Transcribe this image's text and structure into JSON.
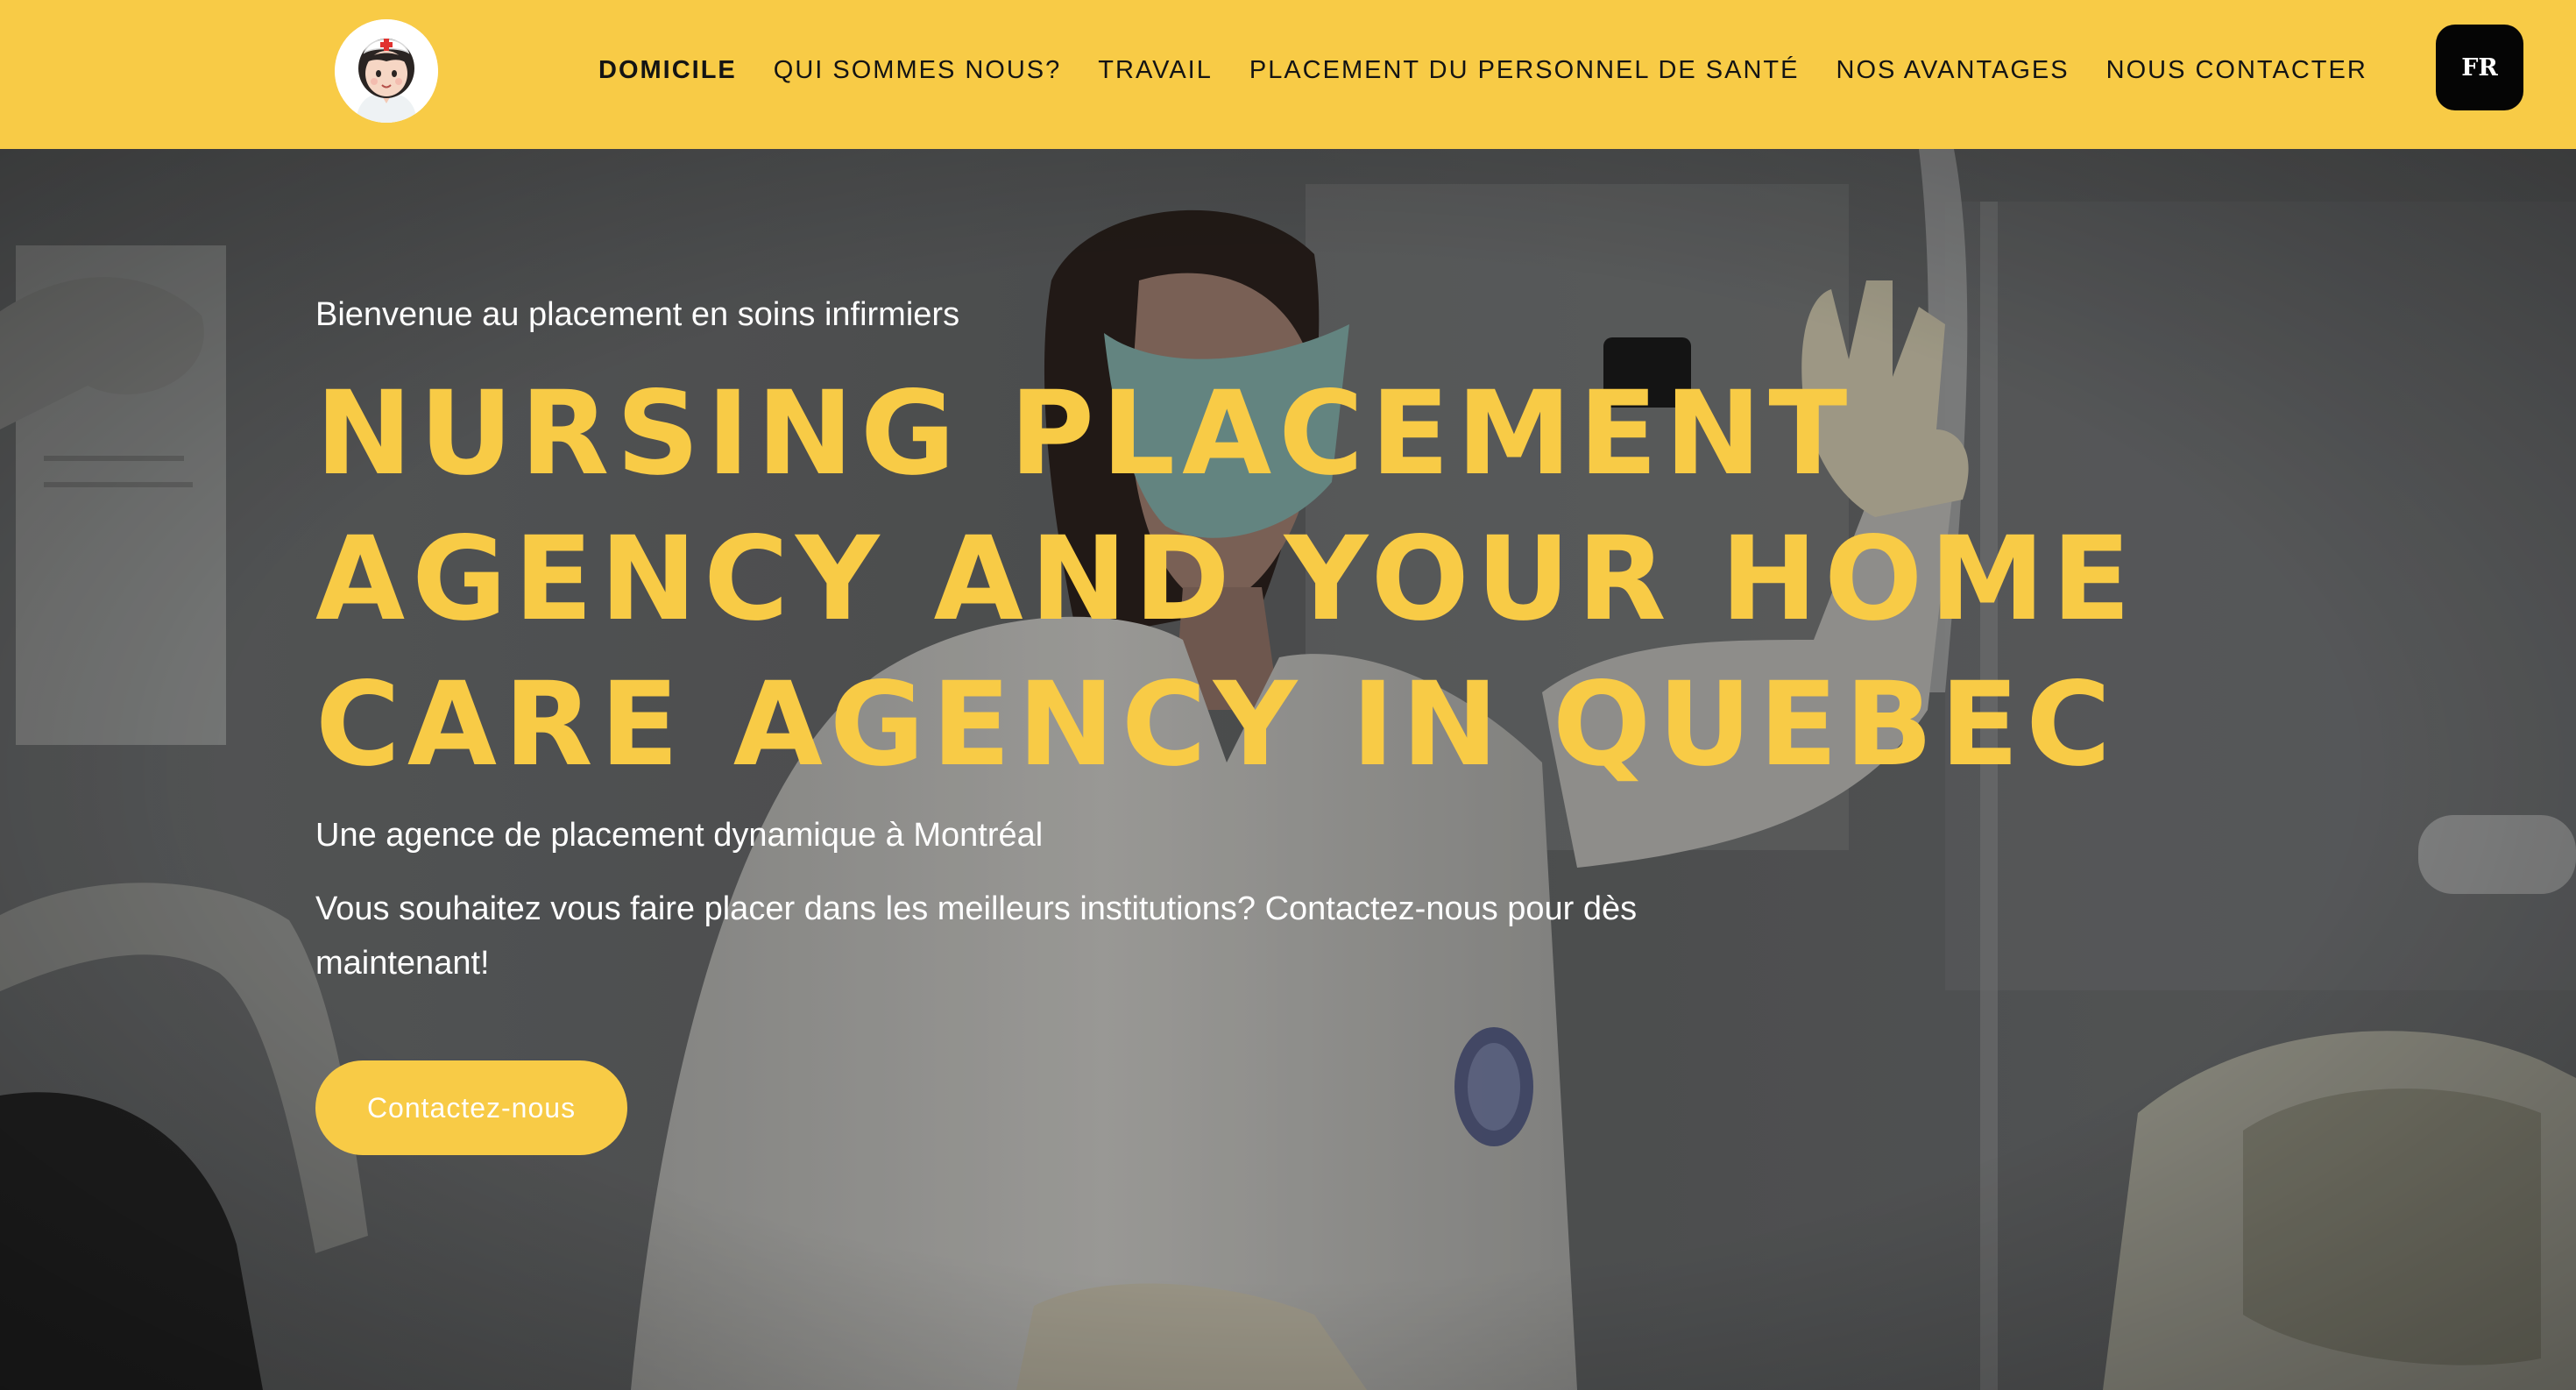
{
  "colors": {
    "accent": "#f8cb46",
    "header_bg": "#f8cb46",
    "lang_button_bg": "#050505",
    "text_dark": "#141414",
    "text_light": "#ffffff"
  },
  "header": {
    "logo_icon": "nurse-avatar-icon",
    "nav": [
      {
        "label": "DOMICILE",
        "active": true
      },
      {
        "label": "QUI SOMMES NOUS?",
        "active": false
      },
      {
        "label": "TRAVAIL",
        "active": false
      },
      {
        "label": "PLACEMENT DU PERSONNEL DE SANTÉ",
        "active": false
      },
      {
        "label": "NOS AVANTAGES",
        "active": false
      },
      {
        "label": "NOUS CONTACTER",
        "active": false
      }
    ],
    "language_button": "FR"
  },
  "hero": {
    "background_icon": "nurse-in-lab-photo",
    "welcome": "Bienvenue au placement en soins infirmiers",
    "headline_lines": [
      "NURSING PLACEMENT",
      "AGENCY AND YOUR HOME",
      "CARE AGENCY IN QUEBEC"
    ],
    "subtitle": "Une agence de placement dynamique à Montréal",
    "description": "Vous souhaitez vous faire placer dans les meilleurs institutions? Contactez-nous pour dès maintenant!",
    "cta_label": "Contactez-nous"
  }
}
